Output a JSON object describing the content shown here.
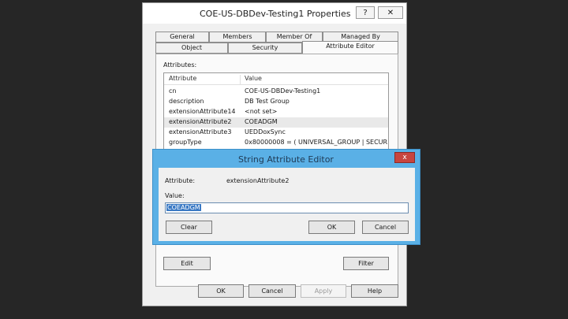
{
  "window": {
    "title": "COE-US-DBDev-Testing1 Properties",
    "help_label": "?",
    "close_label": "✕"
  },
  "tabs": {
    "row1": [
      "General",
      "Members",
      "Member Of",
      "Managed By"
    ],
    "row2": [
      "Object",
      "Security",
      "Attribute Editor"
    ],
    "active": "Attribute Editor"
  },
  "attributes": {
    "group_label": "Attributes:",
    "columns": [
      "Attribute",
      "Value"
    ],
    "rows": [
      {
        "attribute": "cn",
        "value": "COE-US-DBDev-Testing1"
      },
      {
        "attribute": "description",
        "value": "DB Test Group"
      },
      {
        "attribute": "extensionAttribute14",
        "value": "<not set>"
      },
      {
        "attribute": "extensionAttribute2",
        "value": "COEADGM"
      },
      {
        "attribute": "extensionAttribute3",
        "value": "UEDDoxSync"
      },
      {
        "attribute": "groupType",
        "value": "0x80000008 = ( UNIVERSAL_GROUP | SECUR"
      }
    ],
    "selected_index": 3
  },
  "panel_buttons": {
    "edit": "Edit",
    "filter": "Filter"
  },
  "dialog_buttons": {
    "ok": "OK",
    "cancel": "Cancel",
    "apply": "Apply",
    "help": "Help"
  },
  "editor": {
    "title": "String Attribute Editor",
    "close_label": "x",
    "attribute_label": "Attribute:",
    "attribute_value": "extensionAttribute2",
    "value_label": "Value:",
    "value": "COEADGM",
    "buttons": {
      "clear": "Clear",
      "ok": "OK",
      "cancel": "Cancel"
    }
  },
  "colors": {
    "editor_frame": "#5ab0e6",
    "close_red": "#c7453f",
    "selection": "#3a79c4"
  }
}
